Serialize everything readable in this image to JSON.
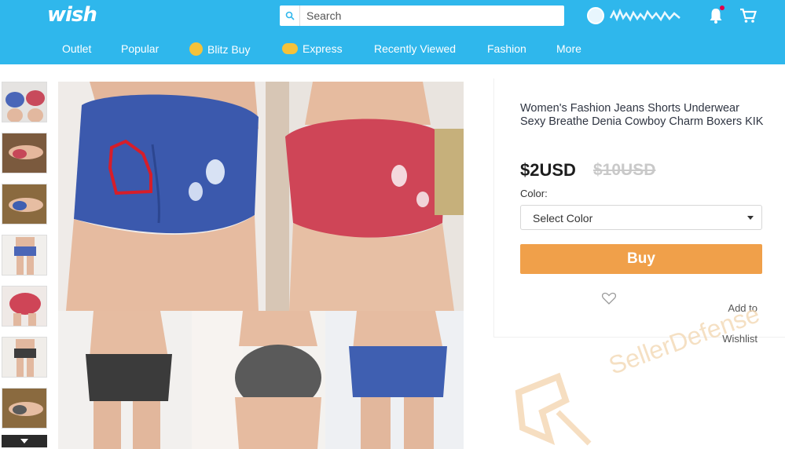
{
  "header": {
    "logo": "wish",
    "search_placeholder": "Search",
    "colors": {
      "brand": "#2fb7ec",
      "buy": "#f0a04a"
    }
  },
  "nav": [
    {
      "label": "Outlet"
    },
    {
      "label": "Popular"
    },
    {
      "label": "Blitz Buy",
      "icon": "blitz-badge-icon"
    },
    {
      "label": "Express",
      "icon": "truck-icon"
    },
    {
      "label": "Recently Viewed"
    },
    {
      "label": "Fashion"
    },
    {
      "label": "More"
    }
  ],
  "product": {
    "title": "Women's Fashion Jeans Shorts Underwear Sexy Breathe Denia Cowboy Charm Boxers KIK",
    "price": "$2USD",
    "old_price": "$10USD",
    "color_label": "Color:",
    "select_color": "Select Color",
    "buy_label": "Buy",
    "wishlist_label": "Add to Wishlist"
  },
  "watermark": {
    "text": "SellerDefense"
  }
}
